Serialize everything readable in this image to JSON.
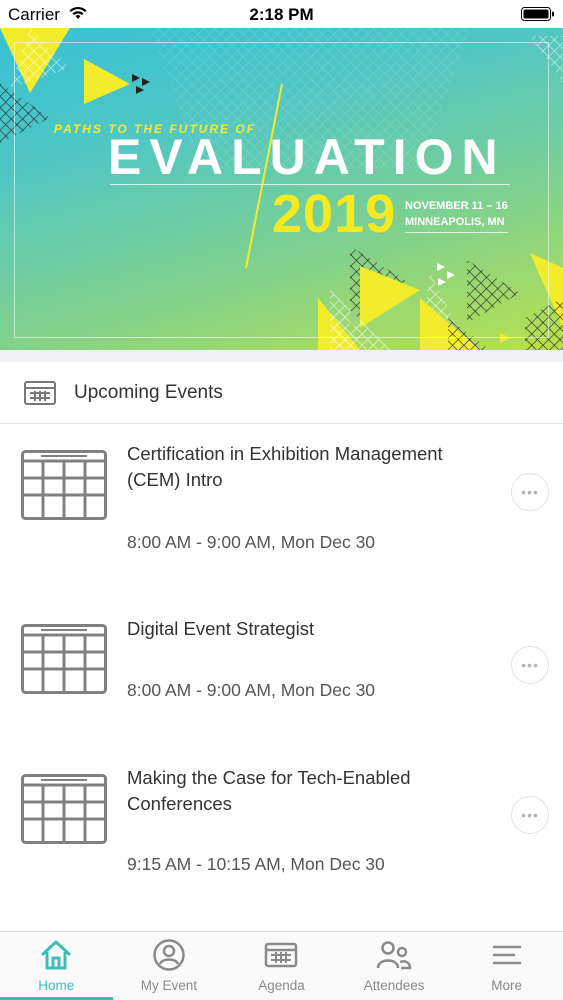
{
  "status_bar": {
    "carrier": "Carrier",
    "time": "2:18 PM"
  },
  "banner": {
    "tagline": "PATHS TO THE FUTURE OF",
    "title": "EVALUATION",
    "year": "2019",
    "dates": "NOVEMBER 11 – 16",
    "location": "MINNEAPOLIS, MN",
    "colors": {
      "yellow": "#f5ea1f",
      "teal": "#37c1d4",
      "green": "#b9e04d"
    }
  },
  "section": {
    "title": "Upcoming Events",
    "icon": "calendar-grid-icon"
  },
  "events": [
    {
      "title": "Certification in Exhibition Management (CEM) Intro",
      "time": "8:00 AM - 9:00 AM, Mon Dec 30"
    },
    {
      "title": "Digital Event Strategist",
      "time": "8:00 AM - 9:00 AM, Mon Dec 30"
    },
    {
      "title": "Making the Case for Tech-Enabled Conferences",
      "time": "9:15 AM - 10:15 AM, Mon Dec 30"
    }
  ],
  "more_dots": "•••",
  "tabs": [
    {
      "label": "Home",
      "icon": "home-icon",
      "active": true
    },
    {
      "label": "My Event",
      "icon": "user-circle-icon",
      "active": false
    },
    {
      "label": "Agenda",
      "icon": "agenda-icon",
      "active": false
    },
    {
      "label": "Attendees",
      "icon": "attendees-icon",
      "active": false
    },
    {
      "label": "More",
      "icon": "menu-icon",
      "active": false
    }
  ],
  "accent_color": "#3dbdb8"
}
